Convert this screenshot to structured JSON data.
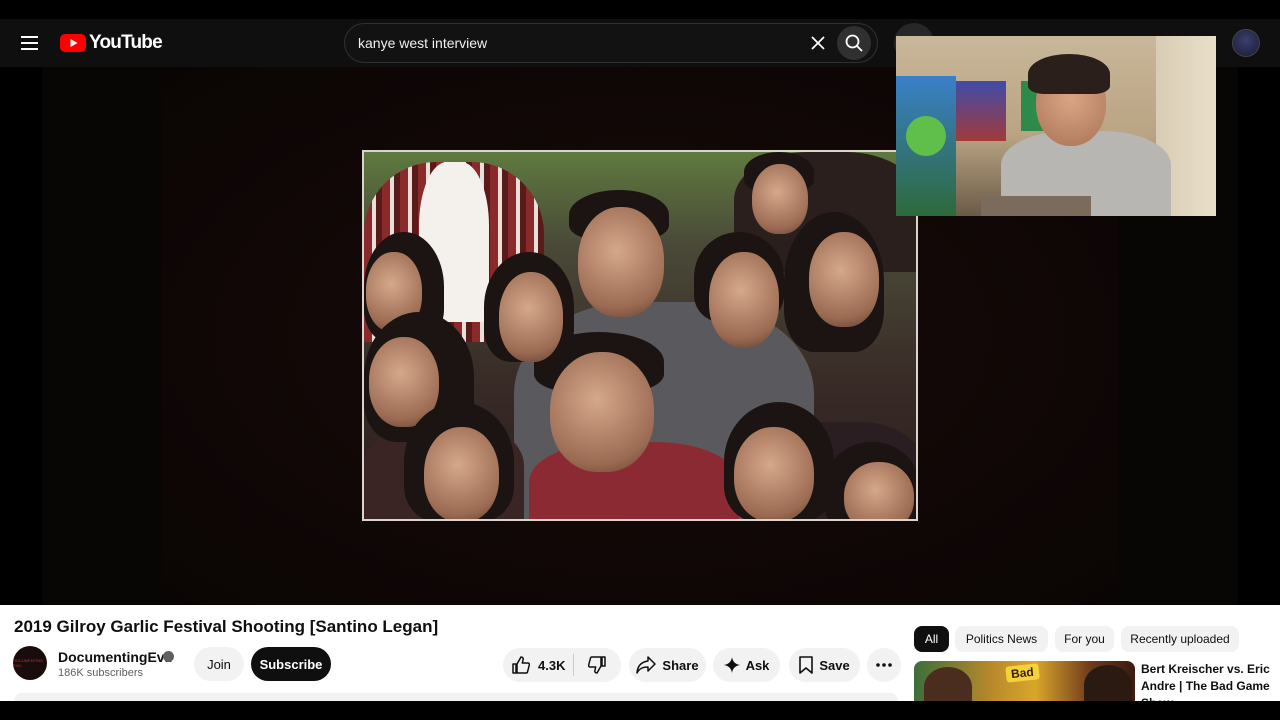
{
  "header": {
    "logo_text": "YouTube",
    "search_value": "kanye west interview"
  },
  "video": {
    "title": "2019 Gilroy Garlic Festival Shooting [Santino Legan]"
  },
  "channel": {
    "name": "DocumentingEvil",
    "avatar_text": "DOCUMENTING EVIL",
    "subscribers": "186K subscribers",
    "join_label": "Join",
    "subscribe_label": "Subscribe"
  },
  "actions": {
    "like_count": "4.3K",
    "share_label": "Share",
    "ask_label": "Ask",
    "save_label": "Save"
  },
  "chips": [
    {
      "label": "All",
      "active": true
    },
    {
      "label": "Politics News",
      "active": false
    },
    {
      "label": "For you",
      "active": false
    },
    {
      "label": "Recently uploaded",
      "active": false
    }
  ],
  "recommended": {
    "title": "Bert Kreischer vs. Eric Andre | The Bad Game Show",
    "thumb_text": "Bad"
  },
  "colors": {
    "brand_red": "#ff0000",
    "masthead_bg": "#0f0f0f",
    "subscribe_bg": "#0f0f0f"
  }
}
